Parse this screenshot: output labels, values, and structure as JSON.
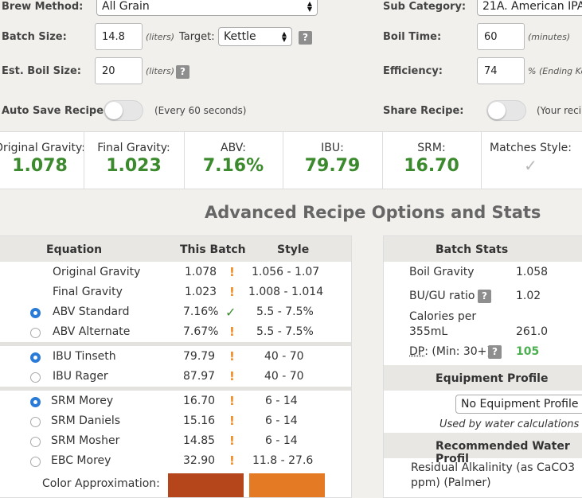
{
  "form": {
    "brew_method_label": "Brew Method:",
    "brew_method_value": "All Grain",
    "sub_category_label": "Sub Category:",
    "sub_category_value": "21A. American IPA",
    "batch_size_label": "Batch Size:",
    "batch_size_value": "14.8",
    "batch_size_unit": "(liters)",
    "target_label": "Target:",
    "target_value": "Kettle",
    "boil_time_label": "Boil Time:",
    "boil_time_value": "60",
    "boil_time_unit": "(minutes)",
    "est_boil_label": "Est. Boil Size:",
    "est_boil_value": "20",
    "est_boil_unit": "(liters)",
    "efficiency_label": "Efficiency:",
    "efficiency_value": "74",
    "efficiency_unit": "% (Ending Ke",
    "auto_save_label": "Auto Save Recipe:",
    "auto_save_note": "(Every 60 seconds)",
    "share_label": "Share Recipe:",
    "share_note": "(Your recip",
    "help_glyph": "?"
  },
  "stats": [
    {
      "label": "Original Gravity:",
      "value": "1.078"
    },
    {
      "label": "Final Gravity:",
      "value": "1.023"
    },
    {
      "label": "ABV:",
      "value": "7.16%"
    },
    {
      "label": "IBU:",
      "value": "79.79"
    },
    {
      "label": "SRM:",
      "value": "16.70"
    },
    {
      "label": "Matches Style:",
      "value": "✓"
    }
  ],
  "advanced_heading": "Advanced Recipe Options and Stats",
  "equation_table": {
    "headers": {
      "equation": "Equation",
      "this_batch": "This Batch",
      "style": "Style"
    },
    "rows": [
      {
        "name": "Original Gravity",
        "value": "1.078",
        "status": "!",
        "style": "1.056 - 1.07"
      },
      {
        "name": "Final Gravity",
        "value": "1.023",
        "status": "!",
        "style": "1.008 - 1.014"
      },
      {
        "name": "ABV Standard",
        "value": "7.16%",
        "status": "✓",
        "style": "5.5 - 7.5%",
        "selected": true
      },
      {
        "name": "ABV Alternate",
        "value": "7.67%",
        "status": "!",
        "style": "5.5 - 7.5%",
        "selected": false
      },
      {
        "name": "IBU Tinseth",
        "value": "79.79",
        "status": "!",
        "style": "40 - 70",
        "selected": true
      },
      {
        "name": "IBU Rager",
        "value": "87.97",
        "status": "!",
        "style": "40 - 70",
        "selected": false
      },
      {
        "name": "SRM Morey",
        "value": "16.70",
        "status": "!",
        "style": "6 - 14",
        "selected": true
      },
      {
        "name": "SRM Daniels",
        "value": "15.16",
        "status": "!",
        "style": "6 - 14",
        "selected": false
      },
      {
        "name": "SRM Mosher",
        "value": "14.85",
        "status": "!",
        "style": "6 - 14",
        "selected": false
      },
      {
        "name": "EBC Morey",
        "value": "32.90",
        "status": "!",
        "style": "11.8 - 27.6",
        "selected": false
      }
    ],
    "color_label": "Color Approximation:",
    "batch_color": "#b5451b",
    "style_color": "#e47a24"
  },
  "batch_stats": {
    "header": "Batch Stats",
    "boil_gravity_label": "Boil Gravity",
    "boil_gravity_value": "1.058",
    "bugu_label": "BU/GU ratio",
    "bugu_value": "1.02",
    "calories_label_1": "Calories per",
    "calories_label_2": "355mL",
    "calories_value": "261.0",
    "dp_label_a": "DP",
    "dp_label_b": ": (Min: 30+)",
    "dp_value": "105",
    "equipment_header": "Equipment Profile",
    "equipment_select": "No Equipment Profile S",
    "equipment_note": "Used by water calculations ar",
    "water_header": "Recommended Water Profil",
    "residual_1": "Residual Alkalinity (as CaCO3",
    "residual_2": "ppm) (Palmer)"
  },
  "colors": {
    "accent_green": "#3c8a2e",
    "warning_orange": "#f08a24",
    "radio_blue": "#2a7ad8"
  }
}
